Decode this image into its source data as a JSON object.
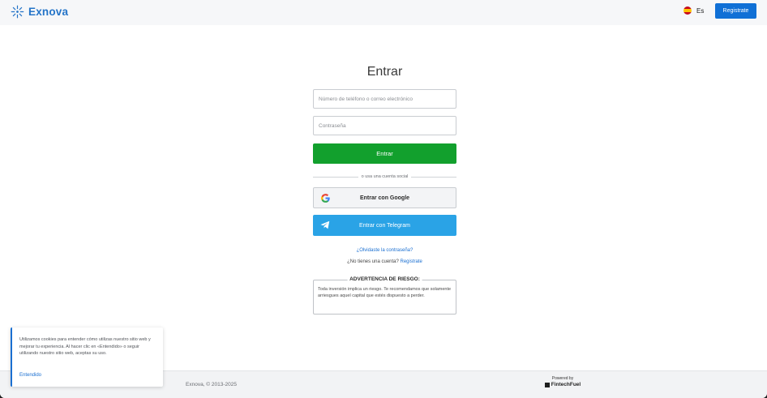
{
  "header": {
    "brand": "Exnova",
    "brand_icon": "sparkle-logo-icon",
    "language": "Es",
    "language_flag_icon": "spain-flag-icon",
    "register_label": "Registrate"
  },
  "login": {
    "title": "Entrar",
    "identifier_placeholder": "Número de teléfono o correo electrónico",
    "password_placeholder": "Contraseña",
    "submit_label": "Entrar",
    "divider_text": "o usa una cuenta social",
    "google_label": "Entrar con Google",
    "telegram_label": "Entrar con Telegram",
    "forgot_label": "¿Olvidaste la contraseña?",
    "no_account_text": "¿No tienes una cuenta?",
    "register_link": "Registrate"
  },
  "risk_warning": {
    "title": "ADVERTENCIA DE RIESGO:",
    "body": "Toda inversión implica un riesgo. Te recomendamos que solamente arriesgues aquel capital que estés dispuesto a perder."
  },
  "cookie_banner": {
    "text": "Utilizamos cookies para entender cómo utilizas nuestro sitio web y mejorar tu experiencia. Al hacer clic en «Entendido» o seguir utilizando nuestro sitio web, aceptas su uso.",
    "accept_label": "Entendido"
  },
  "footer": {
    "copyright": "Exnova, © 2013-2025",
    "powered_by": "Powered by",
    "partner": "FintechFuel"
  },
  "colors": {
    "accent": "#1070d6",
    "login_button": "#12a02d",
    "telegram": "#2aa3e6",
    "brand": "#2474c8"
  }
}
